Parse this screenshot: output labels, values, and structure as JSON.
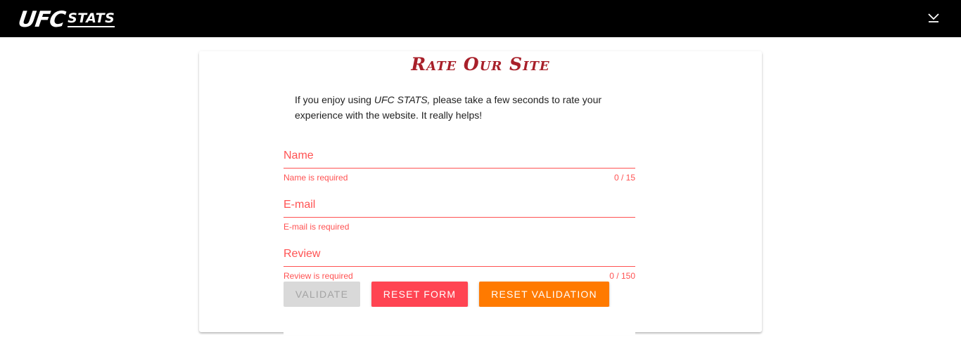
{
  "header": {
    "logo_main": "UFC",
    "logo_sub": "STATS",
    "menu_icon": "chevron-down-icon"
  },
  "card": {
    "title": "Rate Our Site",
    "intro_before": "If you enjoy using ",
    "intro_emphasis": "UFC STATS,",
    "intro_after": " please take a few seconds to rate your experience with the website. It really helps!"
  },
  "form": {
    "fields": [
      {
        "label": "Name",
        "value": "",
        "error": "Name is required",
        "counter": "0 / 15"
      },
      {
        "label": "E-mail",
        "value": "",
        "error": "E-mail is required",
        "counter": ""
      },
      {
        "label": "Review",
        "value": "",
        "error": "Review is required",
        "counter": "0 / 150"
      }
    ],
    "buttons": {
      "validate": "VALIDATE",
      "reset_form": "RESET FORM",
      "reset_validation": "RESET VALIDATION"
    },
    "validate_disabled": true
  },
  "colors": {
    "topbar": "#000000",
    "title": "#a8202a",
    "error": "#ff5252",
    "reset_form": "#ff4452",
    "reset_validation": "#ff7a00",
    "validate_disabled": "#d9d9d9"
  }
}
